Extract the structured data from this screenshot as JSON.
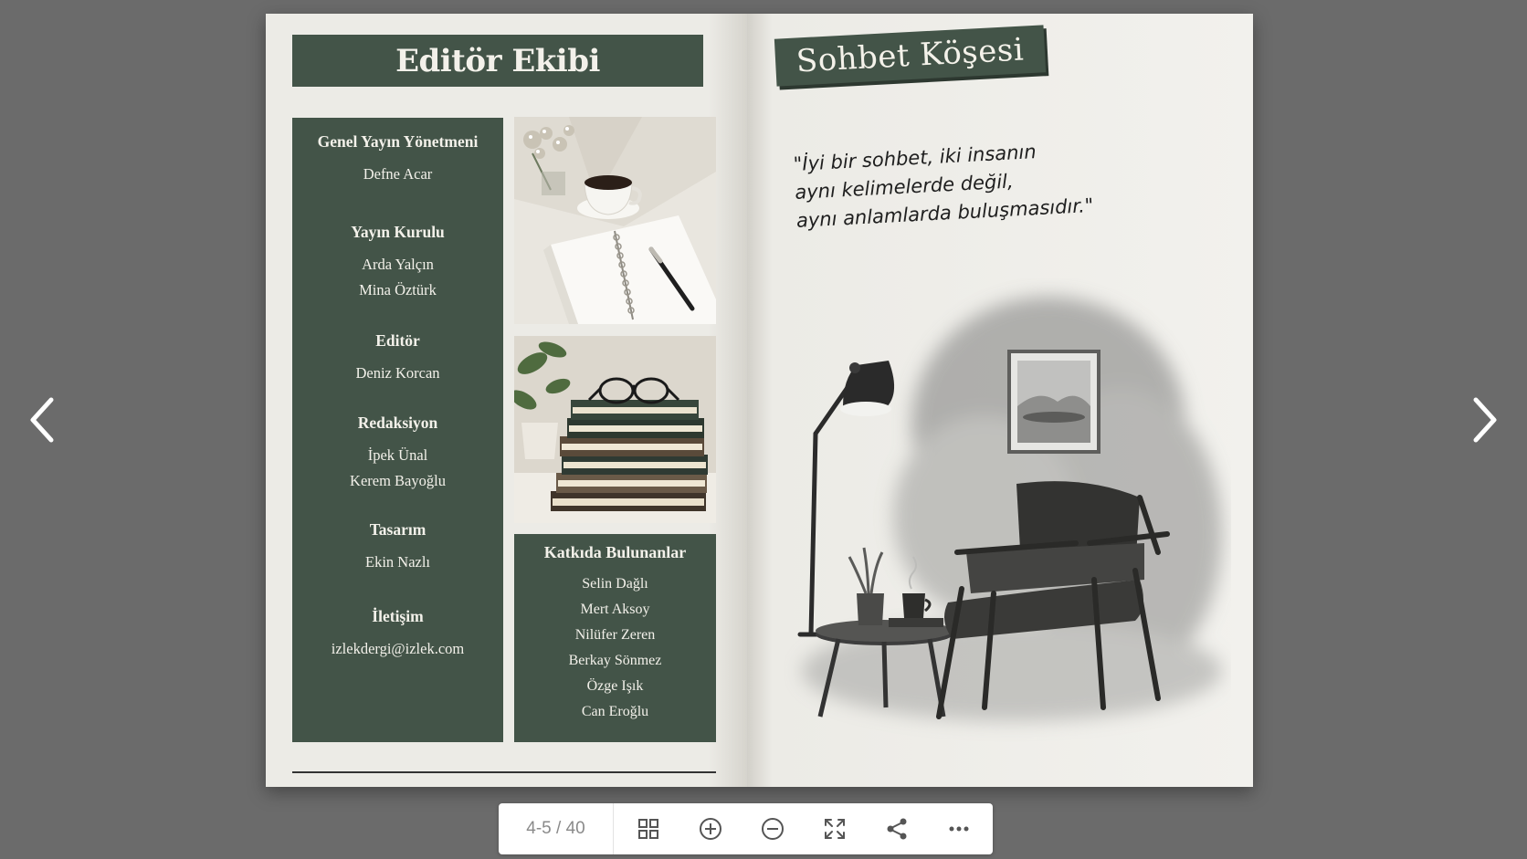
{
  "left_page": {
    "title": "Editör Ekibi",
    "staff": [
      {
        "role": "Genel Yayın Yönetmeni",
        "names": [
          "Defne Acar"
        ]
      },
      {
        "role": "Yayın Kurulu",
        "names": [
          "Arda Yalçın",
          "Mina Öztürk"
        ]
      },
      {
        "role": "Editör",
        "names": [
          "Deniz Korcan"
        ]
      },
      {
        "role": "Redaksiyon",
        "names": [
          "İpek Ünal",
          "Kerem Bayoğlu"
        ]
      },
      {
        "role": "Tasarım",
        "names": [
          "Ekin Nazlı"
        ]
      },
      {
        "role": "İletişim",
        "names": [
          "izlekdergi@izlek.com"
        ]
      }
    ],
    "contributors": {
      "title": "Katkıda Bulunanlar",
      "names": [
        "Selin Dağlı",
        "Mert Aksoy",
        "Nilüfer Zeren",
        "Berkay Sönmez",
        "Özge Işık",
        "Can Eroğlu"
      ]
    }
  },
  "right_page": {
    "title": "Sohbet Köşesi",
    "quote_lines": [
      "\"İyi bir sohbet, iki insanın",
      "aynı kelimelerde değil,",
      "aynı anlamlarda buluşmasıdır.\""
    ]
  },
  "toolbar": {
    "page_indicator": "4-5 / 40",
    "buttons": [
      "grid-icon",
      "zoom-in-icon",
      "zoom-out-icon",
      "fullscreen-icon",
      "share-icon",
      "more-icon"
    ]
  },
  "colors": {
    "accent_green": "#435448",
    "background": "#6b6b6b",
    "page": "#ecebe6"
  }
}
